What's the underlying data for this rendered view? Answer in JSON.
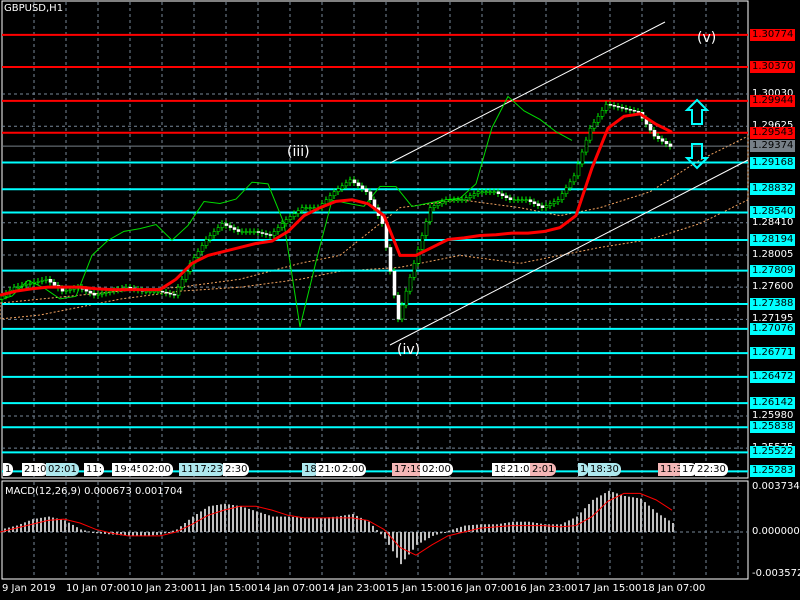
{
  "title": "GBPUSD,H1",
  "wave_labels": {
    "iii": "(iii)",
    "iv": "(iv)",
    "v": "(v)"
  },
  "macd_label": "MACD(12,26,9) 0.000673 0.001704",
  "macd_axis": {
    "top": "0.003734",
    "zero": "0.000000",
    "bottom": "-0.003572"
  },
  "colors": {
    "red_level": "#ff0000",
    "cyan_level": "#00ffff",
    "current": "#778088",
    "ma": "#ff0000",
    "chikou": "#00dd00",
    "cloud": "#f4a460",
    "macd_hist": "#c0c0c0",
    "macd_signal": "#ff0000"
  },
  "price_axis": [
    "1.30030",
    "1.29625",
    "1.28410",
    "1.28005",
    "1.27600",
    "1.27195",
    "1.25980",
    "1.25575"
  ],
  "levels": [
    {
      "price": "1.30774",
      "color": "red"
    },
    {
      "price": "1.30370",
      "color": "red"
    },
    {
      "price": "1.29944",
      "color": "red"
    },
    {
      "price": "1.29543",
      "color": "red"
    },
    {
      "price": "1.29168",
      "color": "cyan"
    },
    {
      "price": "1.28832",
      "color": "cyan"
    },
    {
      "price": "1.28540",
      "color": "cyan"
    },
    {
      "price": "1.28194",
      "color": "cyan"
    },
    {
      "price": "1.27809",
      "color": "cyan"
    },
    {
      "price": "1.27388",
      "color": "cyan"
    },
    {
      "price": "1.27076",
      "color": "cyan"
    },
    {
      "price": "1.26771",
      "color": "cyan"
    },
    {
      "price": "1.26472",
      "color": "cyan"
    },
    {
      "price": "1.26142",
      "color": "cyan"
    },
    {
      "price": "1.25838",
      "color": "cyan"
    },
    {
      "price": "1.25522",
      "color": "cyan"
    },
    {
      "price": "1.25283",
      "color": "cyan"
    }
  ],
  "current_price": "1.29374",
  "time_axis": [
    "9 Jan 2019",
    "10 Jan 07:00",
    "10 Jan 23:00",
    "11 Jan 15:00",
    "14 Jan 07:00",
    "14 Jan 23:00",
    "15 Jan 15:00",
    "16 Jan 07:00",
    "16 Jan 23:00",
    "17 Jan 15:00",
    "18 Jan 07:00"
  ],
  "events": [
    {
      "text": "1",
      "bg": "#ffffff"
    },
    {
      "text": "21:0",
      "bg": "#ffffff"
    },
    {
      "text": "02:01",
      "bg": "#aee8ee"
    },
    {
      "text": "11:",
      "bg": "#ffffff"
    },
    {
      "text": "19:45",
      "bg": "#ffffff"
    },
    {
      "text": "02:00",
      "bg": "#ffffff"
    },
    {
      "text": "11:",
      "bg": "#aee8ee"
    },
    {
      "text": "17:23",
      "bg": "#aee8ee"
    },
    {
      "text": "2:30",
      "bg": "#ffffff"
    },
    {
      "text": "18",
      "bg": "#aee8ee"
    },
    {
      "text": "21:00",
      "bg": "#ffffff"
    },
    {
      "text": "2:00",
      "bg": "#ffffff"
    },
    {
      "text": "17:19",
      "bg": "#f4b6b6"
    },
    {
      "text": "02:00",
      "bg": "#ffffff"
    },
    {
      "text": "18",
      "bg": "#ffffff"
    },
    {
      "text": "21:00",
      "bg": "#ffffff"
    },
    {
      "text": "2:01",
      "bg": "#f4b6b6"
    },
    {
      "text": "1",
      "bg": "#aee8ee"
    },
    {
      "text": "18:30",
      "bg": "#aee8ee"
    },
    {
      "text": "11:3",
      "bg": "#f4b6b6"
    },
    {
      "text": "17",
      "bg": "#ffffff"
    },
    {
      "text": "22:30",
      "bg": "#ffffff"
    }
  ],
  "chart_data": {
    "type": "line",
    "title": "GBPUSD,H1",
    "ylim": [
      1.25,
      1.3115
    ],
    "bar_step": 16,
    "close": [
      1.2745,
      1.276,
      1.2765,
      1.277,
      1.2755,
      1.276,
      1.275,
      1.2755,
      1.276,
      1.2755,
      1.2755,
      1.275,
      1.279,
      1.282,
      1.284,
      1.283,
      1.283,
      1.2825,
      1.2845,
      1.286,
      1.286,
      1.288,
      1.2895,
      1.288,
      1.284,
      1.272,
      1.279,
      1.286,
      1.287,
      1.287,
      1.288,
      1.288,
      1.287,
      1.287,
      1.286,
      1.287,
      1.29,
      1.296,
      1.299,
      1.2985,
      1.298,
      1.295,
      1.2937
    ],
    "ma": [
      1.275,
      1.2755,
      1.2758,
      1.276,
      1.276,
      1.276,
      1.2758,
      1.2757,
      1.2757,
      1.2757,
      1.2757,
      1.277,
      1.279,
      1.28,
      1.2805,
      1.281,
      1.2815,
      1.2818,
      1.283,
      1.285,
      1.286,
      1.2868,
      1.287,
      1.2865,
      1.285,
      1.28,
      1.28,
      1.281,
      1.282,
      1.2822,
      1.2825,
      1.2826,
      1.2828,
      1.2828,
      1.283,
      1.2835,
      1.285,
      1.291,
      1.296,
      1.2975,
      1.2978,
      1.2965,
      1.2955
    ],
    "macd_hist": [
      0.0002,
      0.0005,
      0.001,
      0.0012,
      0.0009,
      0.0002,
      -0.0001,
      -0.0002,
      -0.0003,
      -0.0003,
      -0.0002,
      0.0002,
      0.0012,
      0.002,
      0.0022,
      0.002,
      0.0016,
      0.0012,
      0.0012,
      0.0011,
      0.0011,
      0.0012,
      0.0014,
      0.0008,
      -0.0005,
      -0.0025,
      -0.001,
      -0.0003,
      0.0001,
      0.0005,
      0.0006,
      0.0006,
      0.0008,
      0.0008,
      0.0006,
      0.0006,
      0.0012,
      0.0025,
      0.0032,
      0.0028,
      0.0026,
      0.0015,
      0.0007
    ],
    "macd_signal": [
      0.0,
      0.0003,
      0.0006,
      0.0009,
      0.001,
      0.0007,
      0.0002,
      -0.0001,
      -0.0003,
      -0.0003,
      -0.0003,
      0.0,
      0.0006,
      0.0013,
      0.0017,
      0.002,
      0.002,
      0.0017,
      0.0013,
      0.0011,
      0.0011,
      0.0011,
      0.0011,
      0.0009,
      0.0002,
      -0.0012,
      -0.0018,
      -0.001,
      -0.0003,
      0.0,
      0.0003,
      0.0004,
      0.0005,
      0.0005,
      0.0005,
      0.0004,
      0.0005,
      0.0012,
      0.0024,
      0.003,
      0.003,
      0.0025,
      0.0017
    ],
    "macd_ylim": [
      -0.003572,
      0.003734
    ]
  }
}
